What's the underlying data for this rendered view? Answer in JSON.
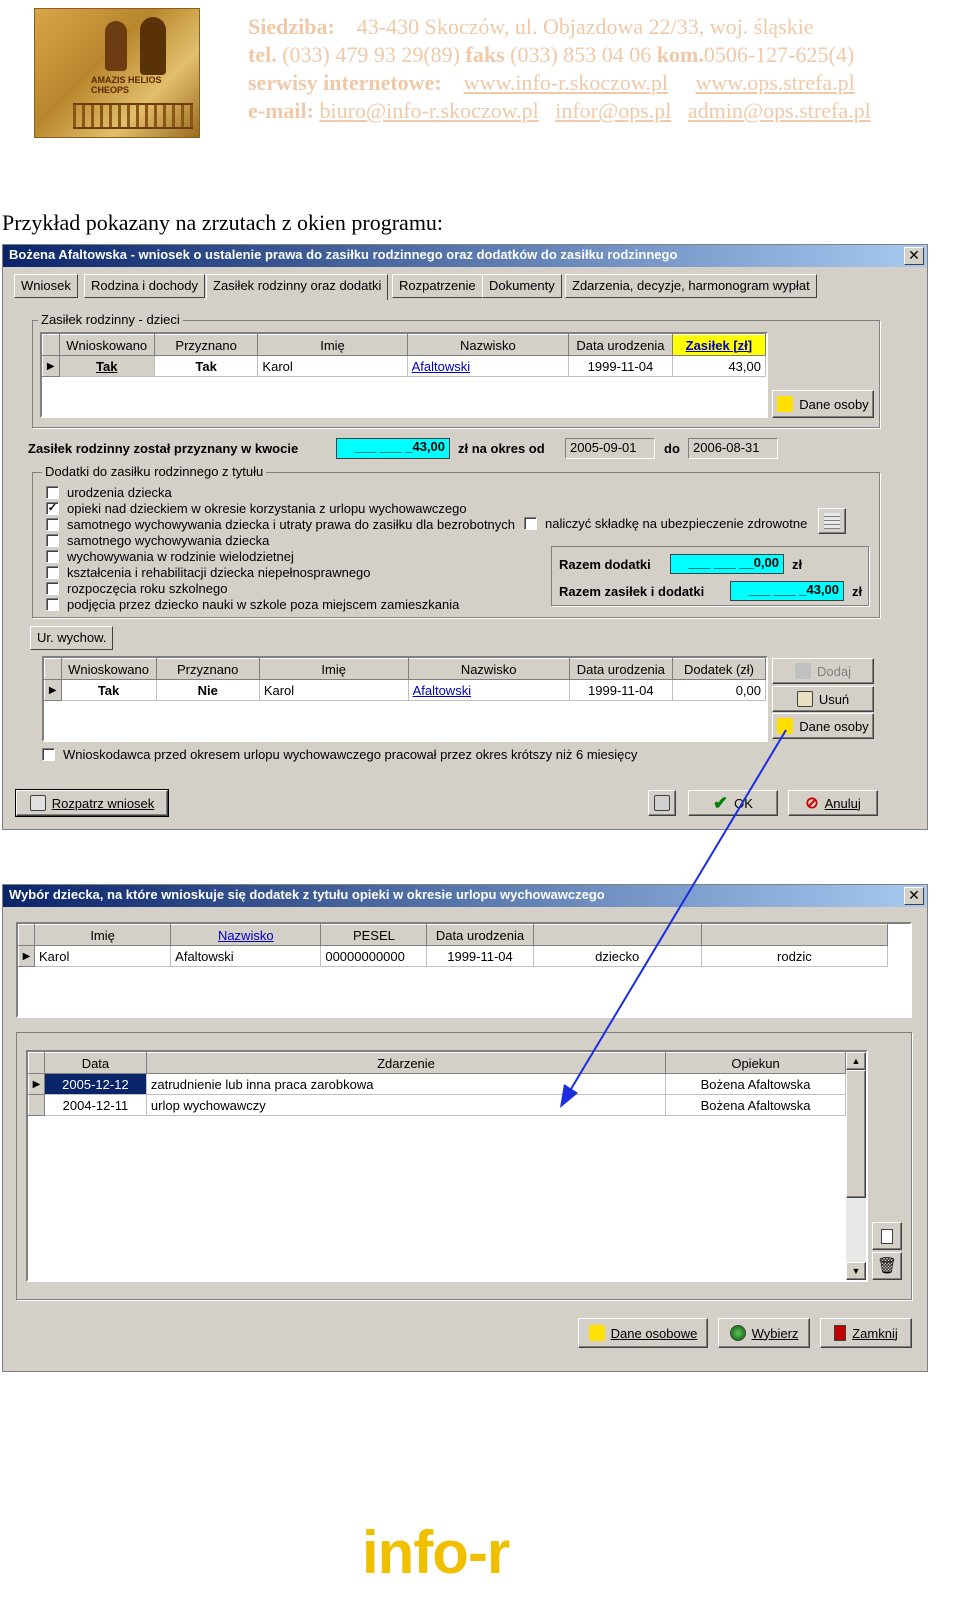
{
  "header": {
    "logo_text": "AMAZIS HELIOS CHEOPS",
    "siedziba_label": "Siedziba:",
    "siedziba": "43-430 Skoczów,    ul. Objazdowa 22/33,     woj. śląskie",
    "tel_label": "tel.",
    "tel": "(033) 479 93 29(89)",
    "faks_label": "faks",
    "faks": "(033) 853 04 06",
    "kom_label": "kom.",
    "kom": "0506-127-625(4)",
    "serwisy_label": "serwisy internetowe:",
    "www1": "www.info-r.skoczow.pl",
    "www2": "www.ops.strefa.pl",
    "email_label": "e-mail:",
    "email1": "biuro@info-r.skoczow.pl",
    "email2": "infor@ops.pl",
    "email3": "admin@ops.strefa.pl"
  },
  "caption": "Przykład pokazany na zrzutach z okien programu:",
  "win1": {
    "title": "Bożena Afaltowska - wniosek o ustalenie prawa do zasiłku rodzinnego oraz dodatków do zasiłku rodzinnego",
    "tabs": [
      "Wniosek",
      "Rodzina i dochody",
      "Zasiłek rodzinny oraz dodatki",
      "Rozpatrzenie",
      "Dokumenty",
      "Zdarzenia, decyzje, harmonogram wypłat"
    ],
    "group1_label": "Zasiłek rodzinny - dzieci",
    "table1_headers": [
      "Wnioskowano",
      "Przyznano",
      "Imię",
      "Nazwisko",
      "Data urodzenia",
      "Zasiłek  [zł]"
    ],
    "table1_row": [
      "Tak",
      "Tak",
      "Karol",
      "Afaltowski",
      "1999-11-04",
      "43,00"
    ],
    "dane_osoby": "Dane osoby",
    "przyznany_label": "Zasiłek rodzinny został przyznany w kwocie",
    "przyznany_value": "___ ___ _43,00",
    "zl_na_okres": "zł na okres od",
    "okres_od": "2005-09-01",
    "do_label": "do",
    "okres_do": "2006-08-31",
    "group2_label": "Dodatki do zasiłku rodzinnego z tytułu",
    "checks": [
      {
        "label": "urodzenia dziecka",
        "checked": ""
      },
      {
        "label": "opieki nad dzieckiem w okresie korzystania z urlopu wychowawczego",
        "checked": "✓"
      },
      {
        "label": "samotnego wychowywania dziecka i utraty prawa do zasiłku dla bezrobotnych",
        "checked": ""
      },
      {
        "label": "samotnego wychowywania dziecka",
        "checked": ""
      },
      {
        "label": "wychowywania w rodzinie wielodzietnej",
        "checked": ""
      },
      {
        "label": "kształcenia i rehabilitacji dziecka niepełnosprawnego",
        "checked": ""
      },
      {
        "label": "rozpoczęcia roku szkolnego",
        "checked": ""
      },
      {
        "label": "podjęcia przez dziecko nauki w szkole poza miejscem zamieszkania",
        "checked": ""
      }
    ],
    "naliczyc": "naliczyć składkę na ubezpieczenie zdrowotne",
    "razem_dodatki_label": "Razem dodatki",
    "razem_dodatki": "___ ___ __0,00",
    "zl": "zł",
    "razem_zasilek_label": "Razem zasiłek i dodatki",
    "razem_zasilek": "___ ___ _43,00",
    "ur_wychow_tab": "Ur. wychow.",
    "table2_headers": [
      "Wnioskowano",
      "Przyznano",
      "Imię",
      "Nazwisko",
      "Data urodzenia",
      "Dodatek  (zł)"
    ],
    "table2_row": [
      "Tak",
      "Nie",
      "Karol",
      "Afaltowski",
      "1999-11-04",
      "0,00"
    ],
    "dodaj": "Dodaj",
    "usun": "Usuń",
    "bottom_check": "Wnioskodawca przed okresem urlopu wychowawczego pracował przez okres krótszy niż 6 miesięcy",
    "rozpatrz": "Rozpatrz wniosek",
    "ok": "OK",
    "anuluj": "Anuluj"
  },
  "win2": {
    "title": "Wybór dziecka, na które wnioskuje się dodatek z tytułu opieki w okresie urlopu wychowawczego",
    "table1_headers": [
      "Imię",
      "Nazwisko",
      "PESEL",
      "Data urodzenia",
      "",
      ""
    ],
    "table1_row": [
      "Karol",
      "Afaltowski",
      "00000000000",
      "1999-11-04",
      "dziecko",
      "rodzic"
    ],
    "table2_headers": [
      "Data",
      "Zdarzenie",
      "Opiekun"
    ],
    "table2_rows": [
      [
        "2005-12-12",
        "zatrudnienie lub inna praca zarobkowa",
        "Bożena Afaltowska"
      ],
      [
        "2004-12-11",
        "urlop wychowawczy",
        "Bożena Afaltowska"
      ]
    ],
    "dane_osobowe": "Dane osobowe",
    "wybierz": "Wybierz",
    "zamknij": "Zamknij"
  },
  "footer_logo": "info-r"
}
